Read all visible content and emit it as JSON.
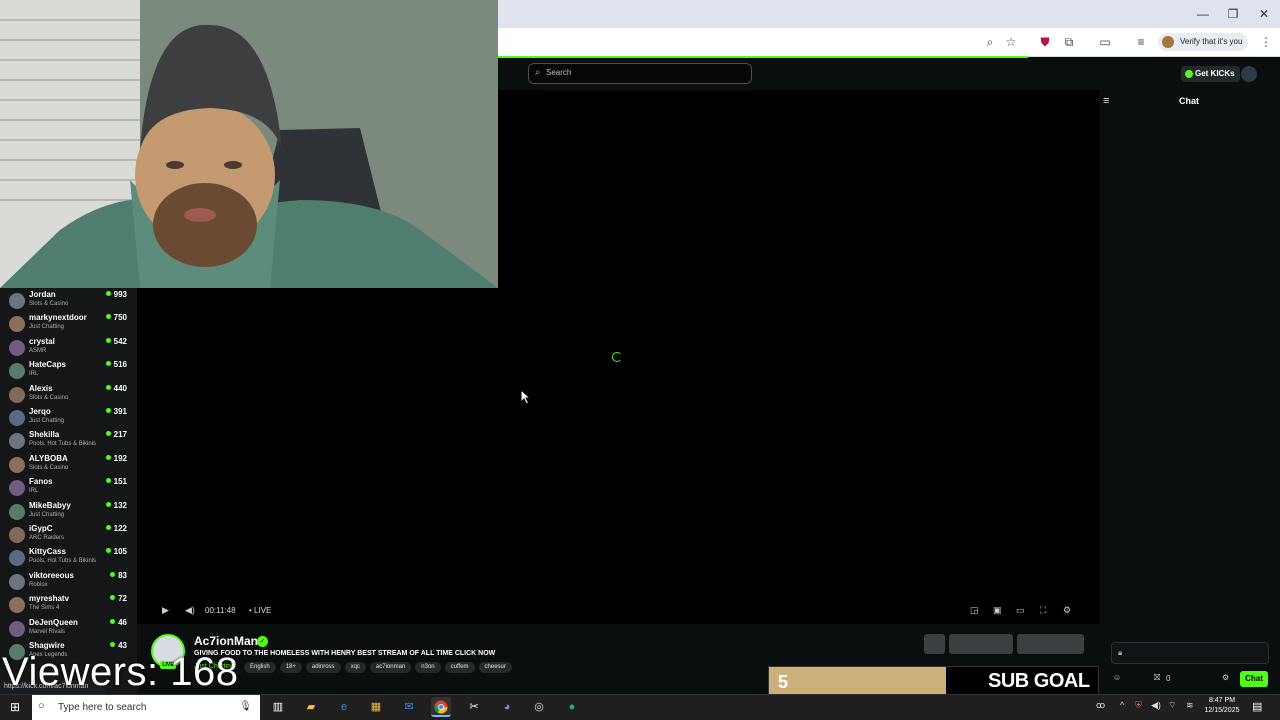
{
  "browser": {
    "verify_label": "Verify that it's you"
  },
  "header": {
    "search_placeholder": "Search",
    "get_kicks_label": "Get KICKs"
  },
  "sidebar": {
    "channels": [
      {
        "name": "Jordan",
        "category": "Slots & Casino",
        "viewers": "993"
      },
      {
        "name": "markynextdoor",
        "category": "Just Chatting",
        "viewers": "750"
      },
      {
        "name": "crystal",
        "category": "ASMR",
        "viewers": "542"
      },
      {
        "name": "HateCaps",
        "category": "IRL",
        "viewers": "516"
      },
      {
        "name": "Alexis",
        "category": "Slots & Casino",
        "viewers": "440"
      },
      {
        "name": "Jerqo",
        "category": "Just Chatting",
        "viewers": "391"
      },
      {
        "name": "Shekilla",
        "category": "Pools, Hot Tubs & Bikinis",
        "viewers": "217"
      },
      {
        "name": "ALYBOBA",
        "category": "Slots & Casino",
        "viewers": "192"
      },
      {
        "name": "Fanos",
        "category": "IRL",
        "viewers": "151"
      },
      {
        "name": "MikeBabyy",
        "category": "Just Chatting",
        "viewers": "132"
      },
      {
        "name": "iGypC",
        "category": "ARC Raiders",
        "viewers": "122"
      },
      {
        "name": "KittyCass",
        "category": "Pools, Hot Tubs & Bikinis",
        "viewers": "105"
      },
      {
        "name": "viktoreeous",
        "category": "Roblox",
        "viewers": "83"
      },
      {
        "name": "myreshatv",
        "category": "The Sims 4",
        "viewers": "72"
      },
      {
        "name": "DeJenQueen",
        "category": "Marvel Rivals",
        "viewers": "46"
      },
      {
        "name": "Shagwire",
        "category": "Apex Legends",
        "viewers": "43"
      }
    ],
    "status_url": "https://kick.com/ac7ionman"
  },
  "player": {
    "time": "00:11:48",
    "live_label": "LIVE"
  },
  "chat": {
    "title": "Chat",
    "kicks_count": "0",
    "chat_button": "Chat"
  },
  "stream": {
    "streamer": "Ac7ionMan",
    "live_badge": "LIVE",
    "title": "GIVING FOOD TO THE HOMELESS WITH HENRY BEST STREAM OF ALL TIME CLICK NOW",
    "category": "Just Chatting",
    "tags": [
      "English",
      "18+",
      "adinross",
      "xqc",
      "ac7ionman",
      "n3on",
      "cuffem",
      "cheesur"
    ]
  },
  "overlay": {
    "viewers_text": "Viewers: 168",
    "sub_goal_count": "5",
    "sub_goal_label": "SUB GOAL"
  },
  "taskbar": {
    "search_placeholder": "Type here to search",
    "time": "8:47 PM",
    "date": "12/15/2025"
  },
  "colors": {
    "kick_green": "#53fc18",
    "sub_goal_fill": "#cbb07a"
  }
}
